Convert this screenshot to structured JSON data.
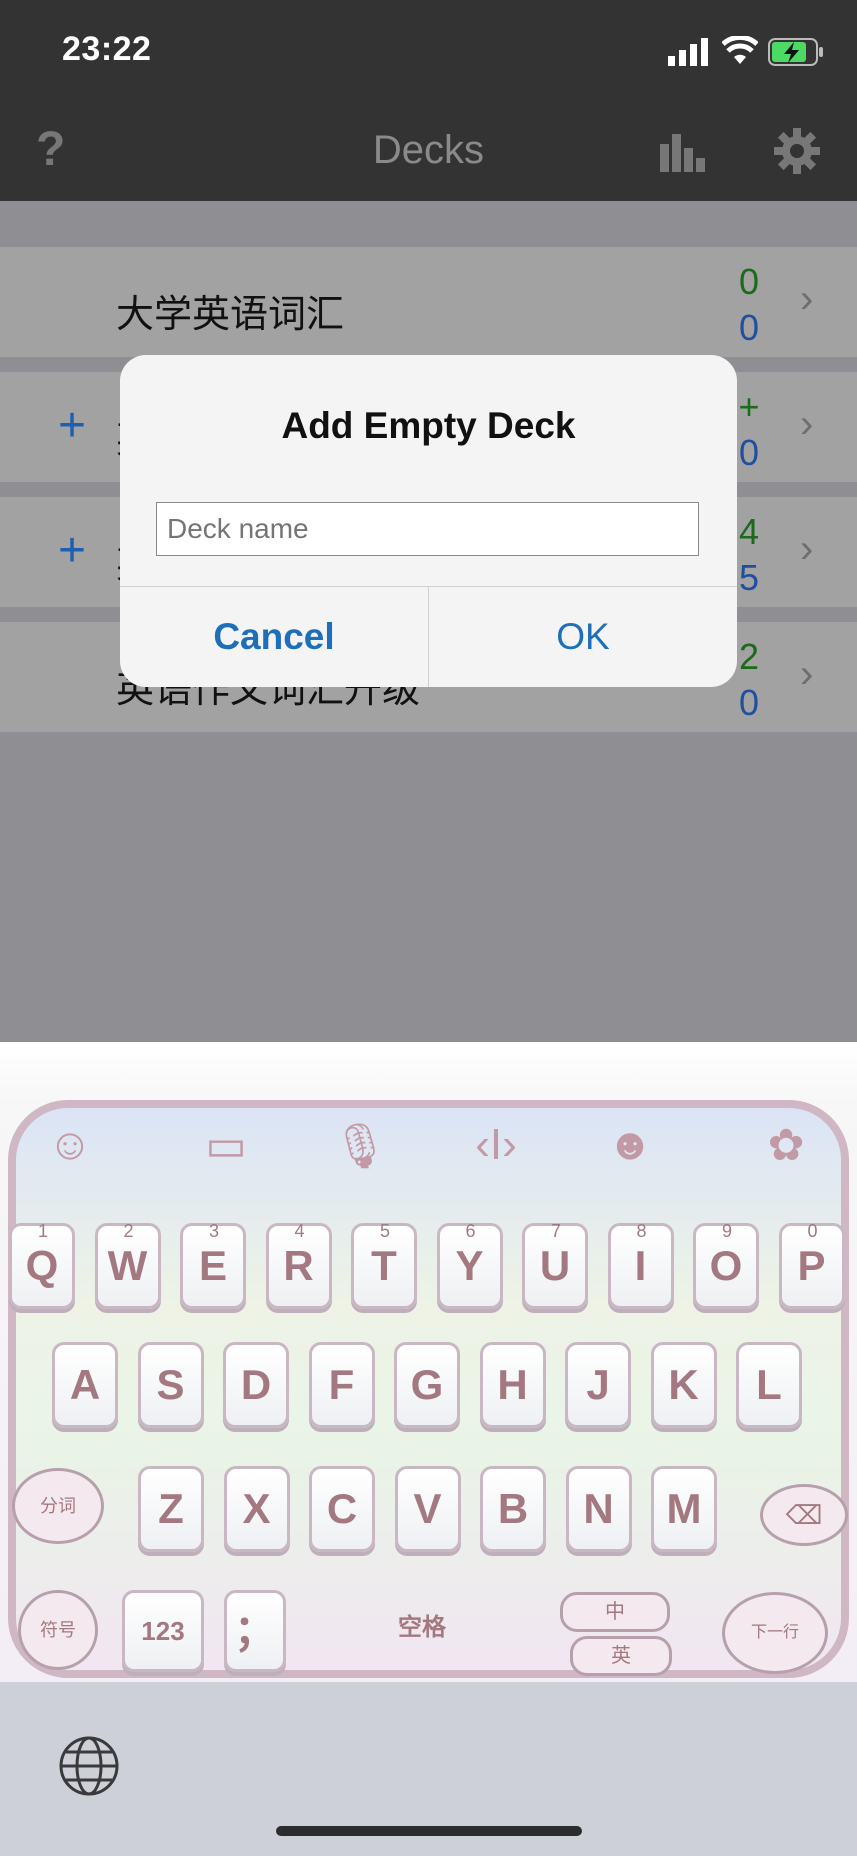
{
  "status": {
    "time": "23:22"
  },
  "nav": {
    "help": "?",
    "title": "Decks"
  },
  "decks": [
    {
      "name": "大学英语词汇",
      "count_top": "0",
      "count_bottom": "0",
      "expand": ""
    },
    {
      "name": "英",
      "count_top": "+",
      "count_bottom": "0",
      "expand": "+"
    },
    {
      "name": "英",
      "count_top": "4",
      "count_bottom": "5",
      "expand": "+"
    },
    {
      "name": "英语作文词汇升级",
      "count_top": "2",
      "count_bottom": "0",
      "expand": ""
    }
  ],
  "dialog": {
    "title": "Add Empty Deck",
    "placeholder": "Deck name",
    "cancel": "Cancel",
    "ok": "OK"
  },
  "keyboard": {
    "row1": [
      "Q",
      "W",
      "E",
      "R",
      "T",
      "Y",
      "U",
      "I",
      "O",
      "P"
    ],
    "row1_nums": [
      "1",
      "2",
      "3",
      "4",
      "5",
      "6",
      "7",
      "8",
      "9",
      "0"
    ],
    "row2": [
      "A",
      "S",
      "D",
      "F",
      "G",
      "H",
      "J",
      "K",
      "L"
    ],
    "row3": [
      "Z",
      "X",
      "C",
      "V",
      "B",
      "N",
      "M"
    ],
    "fenci": "分词",
    "fuhao": "符号",
    "num_key": "123",
    "semicolon": "；",
    "space": "空格",
    "lang_zh": "中",
    "lang_en": "英",
    "newline": "下一行"
  },
  "colors": {
    "count_green": "#1c6a1c",
    "count_blue": "#1f4f9e",
    "ok_blue": "#1e6fba",
    "key_text": "#a47880"
  }
}
